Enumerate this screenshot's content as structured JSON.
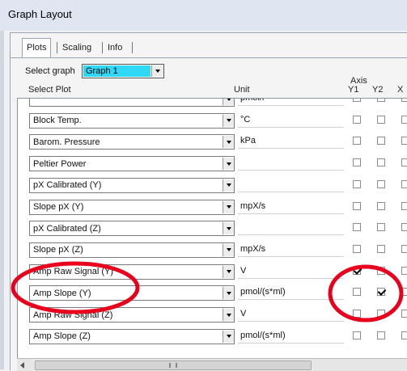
{
  "window": {
    "title": "Graph Layout"
  },
  "tabs": [
    {
      "label": "Plots",
      "active": true
    },
    {
      "label": "Scaling",
      "active": false
    },
    {
      "label": "Info",
      "active": false
    }
  ],
  "graph_select": {
    "label": "Select graph",
    "value": "Graph 1"
  },
  "columns": {
    "select_plot": "Select Plot",
    "unit": "Unit",
    "axis": "Axis",
    "y1": "Y1",
    "y2": "Y2",
    "x": "X"
  },
  "rows": [
    {
      "plot": "",
      "unit": "pmol/l",
      "y1": false,
      "y2": false,
      "x": false
    },
    {
      "plot": "Block Temp.",
      "unit": "°C",
      "y1": false,
      "y2": false,
      "x": false
    },
    {
      "plot": "Barom. Pressure",
      "unit": "kPa",
      "y1": false,
      "y2": false,
      "x": false
    },
    {
      "plot": "Peltier Power",
      "unit": "",
      "y1": false,
      "y2": false,
      "x": false
    },
    {
      "plot": "pX Calibrated (Y)",
      "unit": "",
      "y1": false,
      "y2": false,
      "x": false
    },
    {
      "plot": "Slope pX (Y)",
      "unit": "mpX/s",
      "y1": false,
      "y2": false,
      "x": false
    },
    {
      "plot": "pX Calibrated (Z)",
      "unit": "",
      "y1": false,
      "y2": false,
      "x": false
    },
    {
      "plot": "Slope pX (Z)",
      "unit": "mpX/s",
      "y1": false,
      "y2": false,
      "x": false
    },
    {
      "plot": "Amp Raw Signal (Y)",
      "unit": "V",
      "y1": true,
      "y2": false,
      "x": false
    },
    {
      "plot": "Amp Slope (Y)",
      "unit": "pmol/(s*ml)",
      "y1": false,
      "y2": true,
      "x": false
    },
    {
      "plot": "Amp Raw Signal (Z)",
      "unit": "V",
      "y1": false,
      "y2": false,
      "x": false
    },
    {
      "plot": "Amp Slope (Z)",
      "unit": "pmol/(s*ml)",
      "y1": false,
      "y2": false,
      "x": false
    }
  ],
  "annotation_color": "#e8001c"
}
